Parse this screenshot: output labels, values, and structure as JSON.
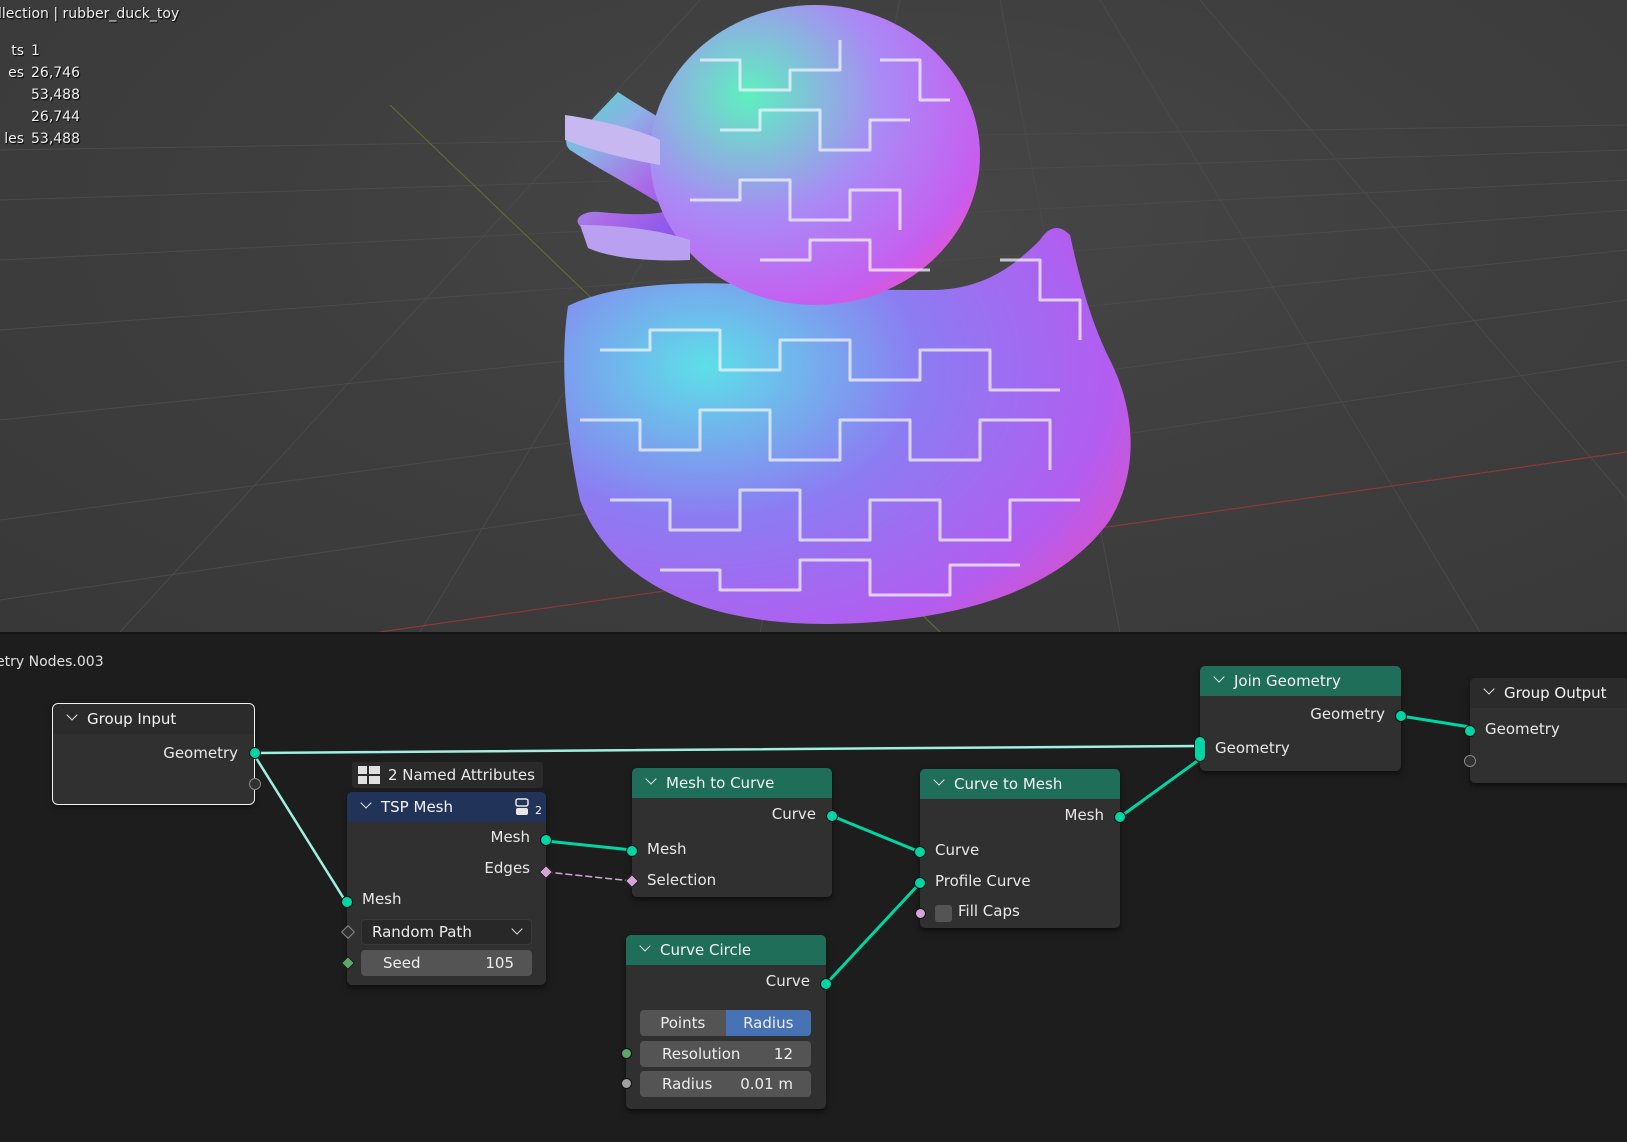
{
  "viewport": {
    "collection_path": {
      "prefix": "llection",
      "object": "rubber_duck_toy"
    },
    "stats": [
      {
        "label": "ts",
        "value": "1"
      },
      {
        "label": "es",
        "value": "26,746"
      },
      {
        "label": "",
        "value": "53,488"
      },
      {
        "label": "",
        "value": "26,744"
      },
      {
        "label": "les",
        "value": "53,488"
      }
    ]
  },
  "editor": {
    "tree_name": "etry Nodes.003",
    "nodes": {
      "group_input": {
        "title": "Group Input",
        "geometry": "Geometry"
      },
      "tsp_mesh": {
        "attributes_badge": "2 Named Attributes",
        "title": "TSP Mesh",
        "usage_count": "2",
        "out_mesh": "Mesh",
        "out_edges": "Edges",
        "in_mesh": "Mesh",
        "mode": "Random Path",
        "seed_label": "Seed",
        "seed_value": "105"
      },
      "mesh_to_curve": {
        "title": "Mesh to Curve",
        "out_curve": "Curve",
        "in_mesh": "Mesh",
        "in_selection": "Selection"
      },
      "curve_circle": {
        "title": "Curve Circle",
        "out_curve": "Curve",
        "mode_points": "Points",
        "mode_radius": "Radius",
        "resolution_label": "Resolution",
        "resolution_value": "12",
        "radius_label": "Radius",
        "radius_value": "0.01 m"
      },
      "curve_to_mesh": {
        "title": "Curve to Mesh",
        "out_mesh": "Mesh",
        "in_curve": "Curve",
        "in_profile": "Profile Curve",
        "in_fill_caps": "Fill Caps"
      },
      "join_geometry": {
        "title": "Join Geometry",
        "out_geometry": "Geometry",
        "in_geometry": "Geometry"
      },
      "group_output": {
        "title": "Group Output",
        "in_geometry": "Geometry"
      }
    }
  },
  "colors": {
    "geometry_node_header": "#1e6e5a",
    "geometry_socket": "#00d6a3",
    "selected_toggle": "#4772b3"
  }
}
